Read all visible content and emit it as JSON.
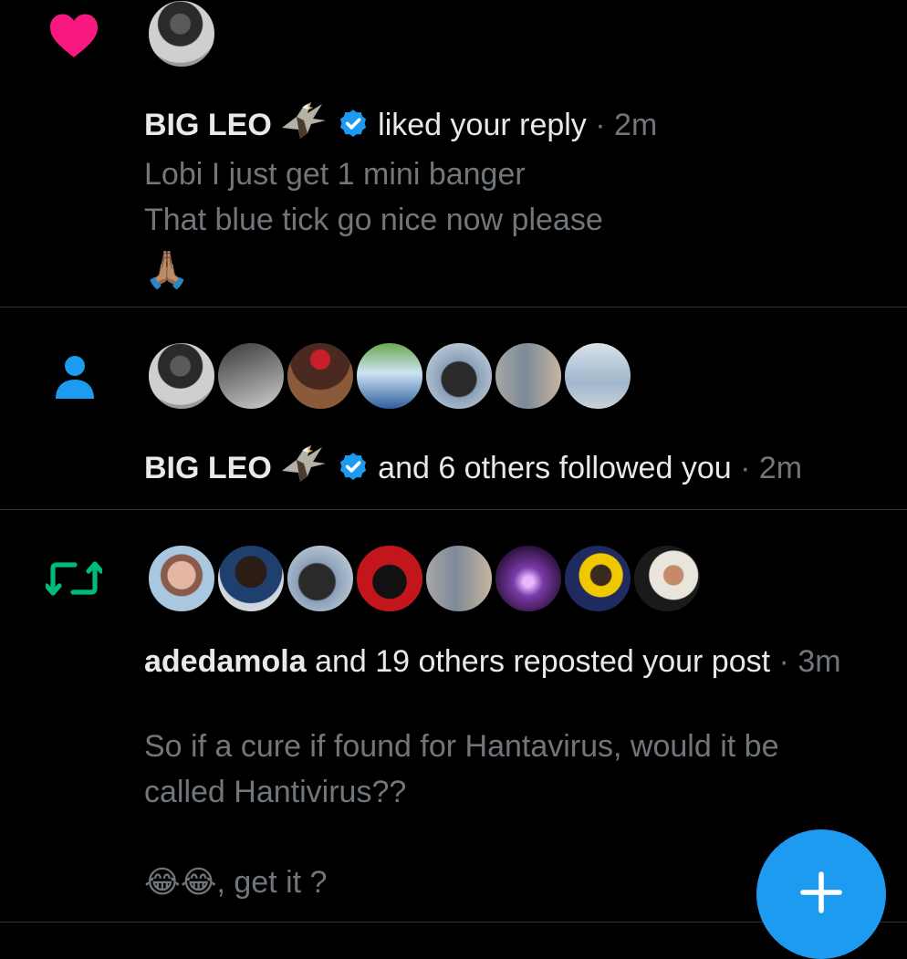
{
  "notifications": [
    {
      "type": "like",
      "icon": "heart-icon",
      "name": "BIG LEO",
      "action": "liked your reply",
      "time": "2m",
      "text_lines": [
        "Lobi I just get 1 mini banger",
        "That blue tick go nice now please"
      ],
      "emoji": "🙏🏽"
    },
    {
      "type": "follow",
      "icon": "person-icon",
      "name": "BIG LEO",
      "action": "and 6 others followed you",
      "time": "2m"
    },
    {
      "type": "repost",
      "icon": "repost-icon",
      "name": "adedamola",
      "action": "and 19 others reposted your post",
      "time": "3m",
      "text_lines": [
        "So if a cure if found for Hantavirus, would it be",
        "called Hantivirus??"
      ],
      "emoji_line": "😂😂",
      "trailing_text": ", get it ?"
    }
  ],
  "fab": {
    "icon": "plus-icon"
  },
  "colors": {
    "like": "#f91880",
    "follow": "#1d9bf0",
    "repost": "#00ba7c",
    "accent": "#1d9bf0"
  }
}
